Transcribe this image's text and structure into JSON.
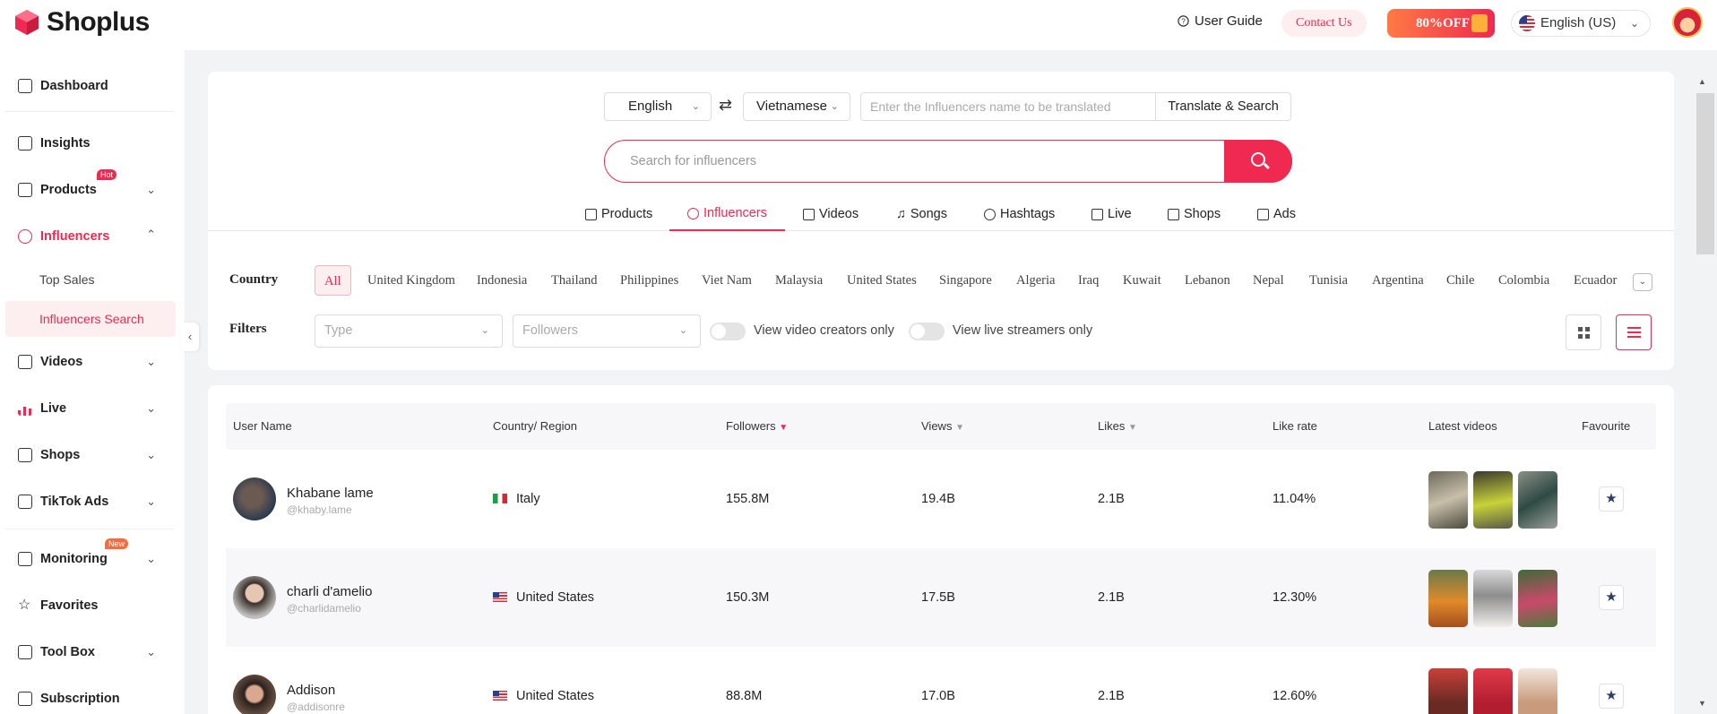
{
  "header": {
    "logo_text": "Shoplus",
    "user_guide": "User Guide",
    "contact": "Contact Us",
    "promo": "80%OFF",
    "language": "English  (US)"
  },
  "sidebar": {
    "dashboard": "Dashboard",
    "insights": "Insights",
    "products": "Products",
    "products_badge": "Hot",
    "influencers": "Influencers",
    "top_sales": "Top Sales",
    "influencers_search": "Influencers Search",
    "videos": "Videos",
    "live": "Live",
    "shops": "Shops",
    "tiktok_ads": "TikTok Ads",
    "monitoring": "Monitoring",
    "monitoring_badge": "New",
    "favorites": "Favorites",
    "tool_box": "Tool Box",
    "subscription": "Subscription"
  },
  "translate": {
    "from_lang": "English",
    "to_lang": "Vietnamese",
    "placeholder": "Enter the Influencers name to be translated",
    "button": "Translate & Search"
  },
  "search": {
    "placeholder": "Search for influencers"
  },
  "tabs": [
    "Products",
    "Influencers",
    "Videos",
    "Songs",
    "Hashtags",
    "Live",
    "Shops",
    "Ads"
  ],
  "filters": {
    "country_label": "Country",
    "countries": [
      "All",
      "United Kingdom",
      "Indonesia",
      "Thailand",
      "Philippines",
      "Viet Nam",
      "Malaysia",
      "United States",
      "Singapore",
      "Algeria",
      "Iraq",
      "Kuwait",
      "Lebanon",
      "Nepal",
      "Tunisia",
      "Argentina",
      "Chile",
      "Colombia",
      "Ecuador"
    ],
    "filters_label": "Filters",
    "type_placeholder": "Type",
    "followers_placeholder": "Followers",
    "video_creators": "View video creators only",
    "live_streamers": "View live streamers only"
  },
  "table": {
    "columns": [
      "User Name",
      "Country/ Region",
      "Followers",
      "Views",
      "Likes",
      "Like rate",
      "Latest videos",
      "Favourite"
    ],
    "rows": [
      {
        "name": "Khabane lame",
        "handle": "@khaby.lame",
        "country": "Italy",
        "followers": "155.8M",
        "views": "19.4B",
        "likes": "2.1B",
        "like_rate": "11.04%"
      },
      {
        "name": "charli d'amelio",
        "handle": "@charlidamelio",
        "country": "United States",
        "followers": "150.3M",
        "views": "17.5B",
        "likes": "2.1B",
        "like_rate": "12.30%"
      },
      {
        "name": "Addison",
        "handle": "@addisonre",
        "country": "United States",
        "followers": "88.8M",
        "views": "17.0B",
        "likes": "2.1B",
        "like_rate": "12.60%"
      }
    ]
  },
  "colors": {
    "accent": "#ef2950",
    "background": "#f2f3f5"
  }
}
